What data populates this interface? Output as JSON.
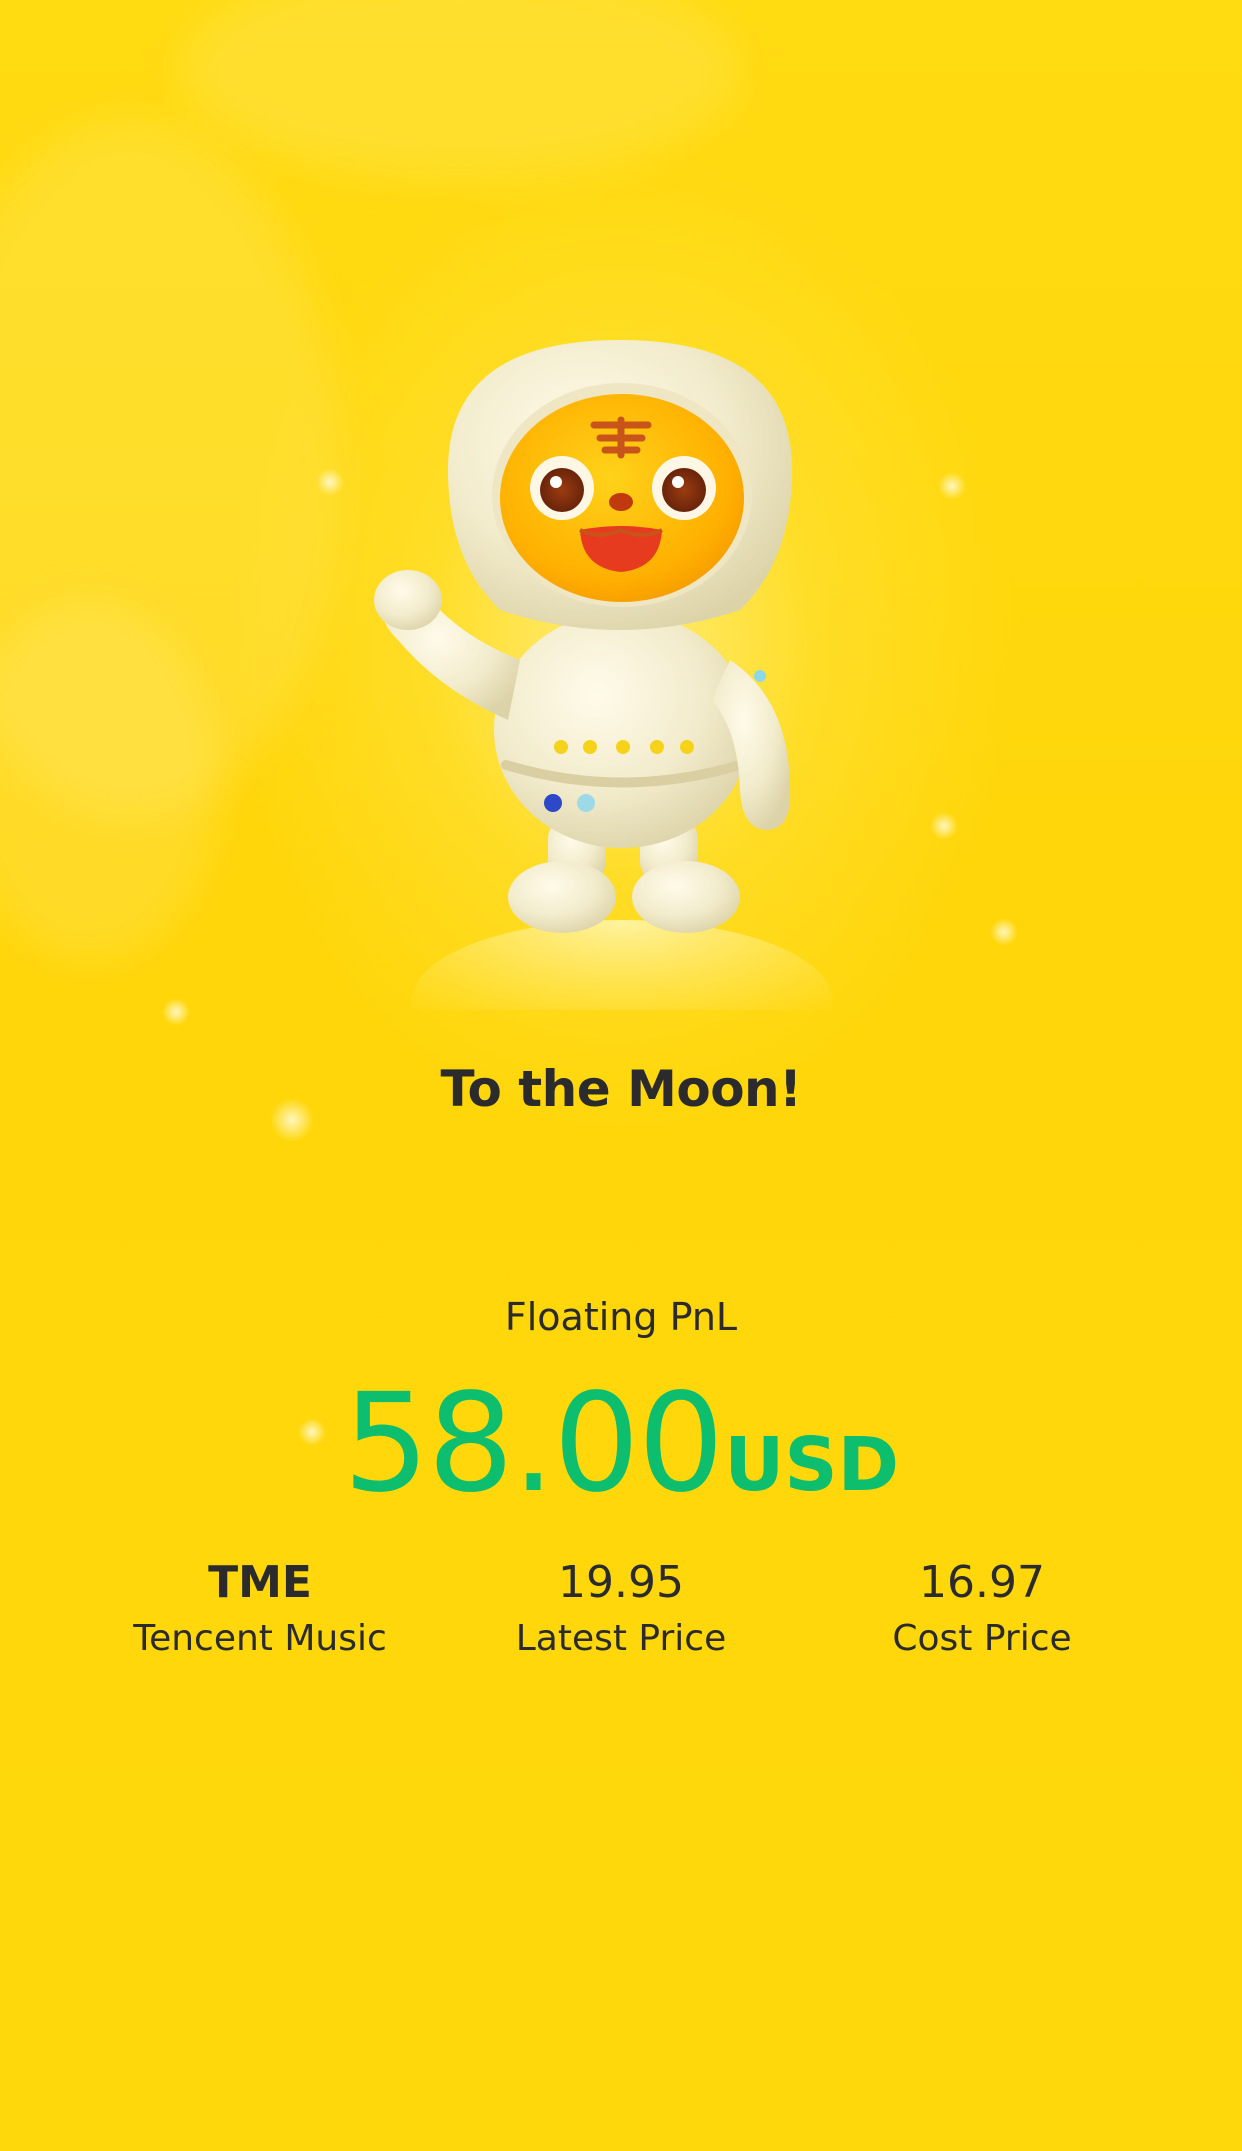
{
  "hero": {
    "illustration": "tiger-astronaut-mascot"
  },
  "headline": "To the Moon!",
  "pnl": {
    "label": "Floating PnL",
    "amount": "58.00",
    "currency": "USD"
  },
  "stats": [
    {
      "value": "TME",
      "label": "Tencent Music"
    },
    {
      "value": "19.95",
      "label": "Latest Price"
    },
    {
      "value": "16.97",
      "label": "Cost Price"
    }
  ],
  "colors": {
    "background": "#FFD90A",
    "gain": "#0CBE6E",
    "text": "#2B2B2E"
  }
}
